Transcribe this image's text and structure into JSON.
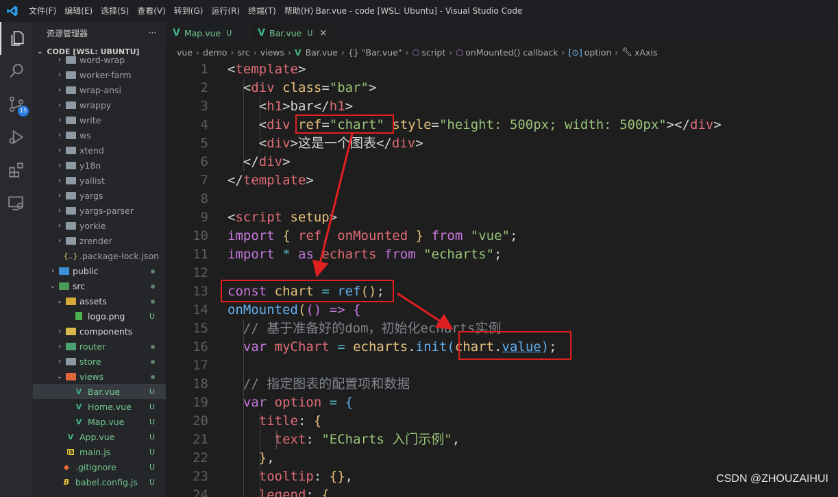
{
  "titlebar": {
    "menu": [
      "文件(F)",
      "编辑(E)",
      "选择(S)",
      "查看(V)",
      "转到(G)",
      "运行(R)",
      "终端(T)",
      "帮助(H)"
    ],
    "window_title": "Bar.vue - code [WSL: Ubuntu] - Visual Studio Code"
  },
  "activity": {
    "badge": "15"
  },
  "sidebar": {
    "title": "资源管理器",
    "more": "···",
    "section": "CODE [WSL: UBUNTU]",
    "items": [
      {
        "label": "word-wrap",
        "status": ""
      },
      {
        "label": "worker-farm",
        "status": ""
      },
      {
        "label": "wrap-ansi",
        "status": ""
      },
      {
        "label": "wrappy",
        "status": ""
      },
      {
        "label": "write",
        "status": ""
      },
      {
        "label": "ws",
        "status": ""
      },
      {
        "label": "xtend",
        "status": ""
      },
      {
        "label": "y18n",
        "status": ""
      },
      {
        "label": "yallist",
        "status": ""
      },
      {
        "label": "yargs",
        "status": ""
      },
      {
        "label": "yargs-parser",
        "status": ""
      },
      {
        "label": "yorkie",
        "status": ""
      },
      {
        "label": "zrender",
        "status": ""
      },
      {
        "label": ".package-lock.json",
        "status": ""
      },
      {
        "label": "public",
        "status": ""
      },
      {
        "label": "src",
        "status": ""
      },
      {
        "label": "assets",
        "status": ""
      },
      {
        "label": "logo.png",
        "status": "U"
      },
      {
        "label": "components",
        "status": ""
      },
      {
        "label": "router",
        "status": "U"
      },
      {
        "label": "store",
        "status": "U"
      },
      {
        "label": "views",
        "status": ""
      },
      {
        "label": "Bar.vue",
        "status": "U"
      },
      {
        "label": "Home.vue",
        "status": "U"
      },
      {
        "label": "Map.vue",
        "status": "U"
      },
      {
        "label": "App.vue",
        "status": "U"
      },
      {
        "label": "main.js",
        "status": "U"
      },
      {
        "label": ".gitignore",
        "status": "U"
      },
      {
        "label": "babel.config.js",
        "status": "U"
      }
    ]
  },
  "tabs": [
    {
      "label": "Map.vue",
      "status": "U"
    },
    {
      "label": "Bar.vue",
      "status": "U",
      "close": "×"
    }
  ],
  "breadcrumb": [
    "vue",
    "demo",
    "src",
    "views",
    "Bar.vue",
    "{} \"Bar.vue\"",
    "script",
    "onMounted() callback",
    "option",
    "xAxis"
  ],
  "editor": {
    "line_numbers": [
      "1",
      "2",
      "3",
      "4",
      "5",
      "6",
      "7",
      "8",
      "9",
      "10",
      "11",
      "12",
      "13",
      "14",
      "15",
      "16",
      "17",
      "18",
      "19",
      "20",
      "21",
      "22",
      "23",
      "24"
    ]
  },
  "watermark": "CSDN @ZHOUZAIHUI"
}
